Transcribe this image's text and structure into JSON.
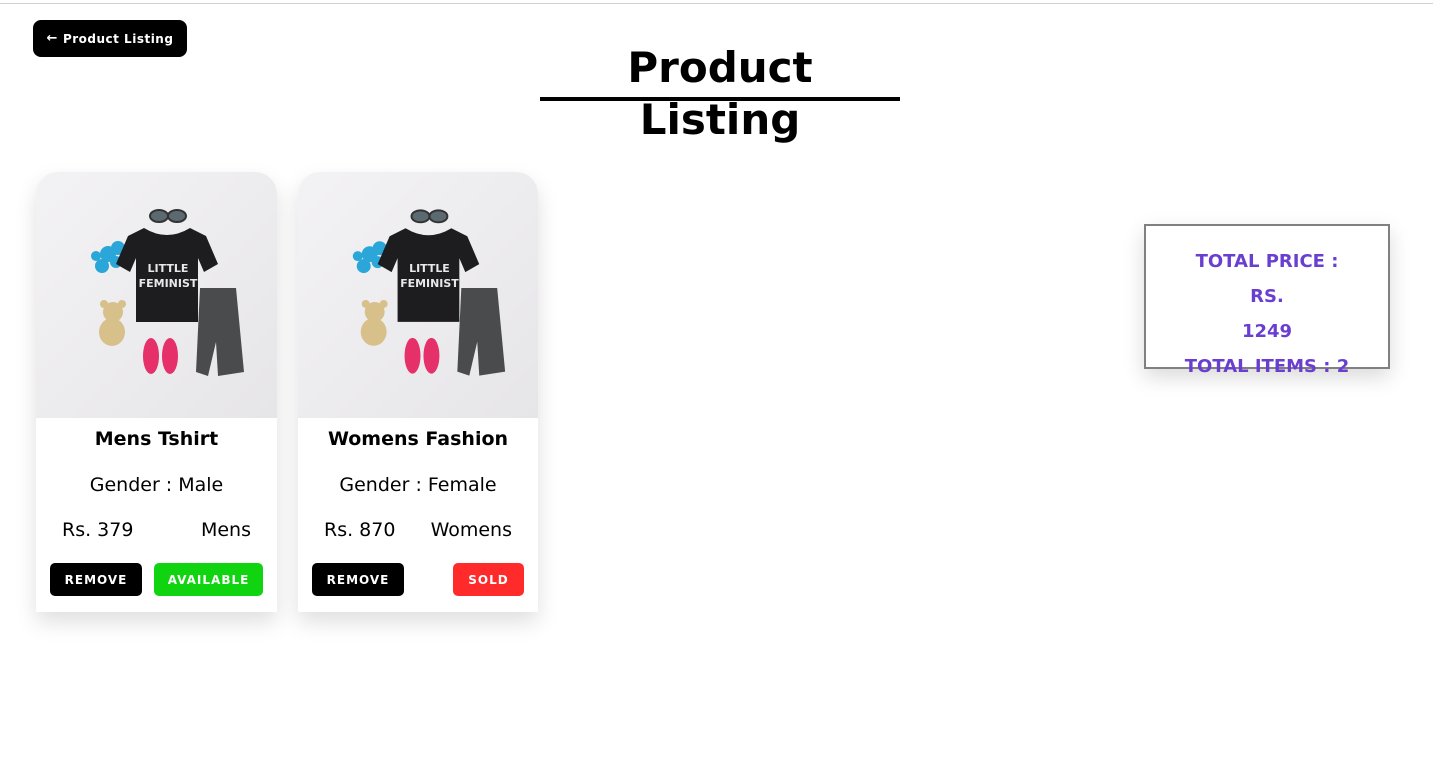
{
  "header": {
    "back_button_arrow": "←",
    "back_button_label": "Product Listing",
    "page_title": "Product Listing"
  },
  "products": [
    {
      "name": "Mens Tshirt",
      "gender_text": "Gender : Male",
      "price_text": "Rs. 379",
      "category": "Mens",
      "remove_label": "REMOVE",
      "status_label": "AVAILABLE",
      "status_color": "#10d410",
      "image_icon": "kids-outfit-flatlay-image",
      "shirt_text_line1": "LITTLE",
      "shirt_text_line2": "FEMINIST"
    },
    {
      "name": "Womens Fashion",
      "gender_text": "Gender : Female",
      "price_text": "Rs. 870",
      "category": "Womens",
      "remove_label": "REMOVE",
      "status_label": "SOLD",
      "status_color": "#ff2a2a",
      "image_icon": "kids-outfit-flatlay-image",
      "shirt_text_line1": "LITTLE",
      "shirt_text_line2": "FEMINIST"
    }
  ],
  "summary": {
    "total_price_line": "TOTAL PRICE : RS.",
    "total_price_value": "1249",
    "total_items_line": "TOTAL ITEMS : 2",
    "text_color": "#6a3fd0"
  }
}
